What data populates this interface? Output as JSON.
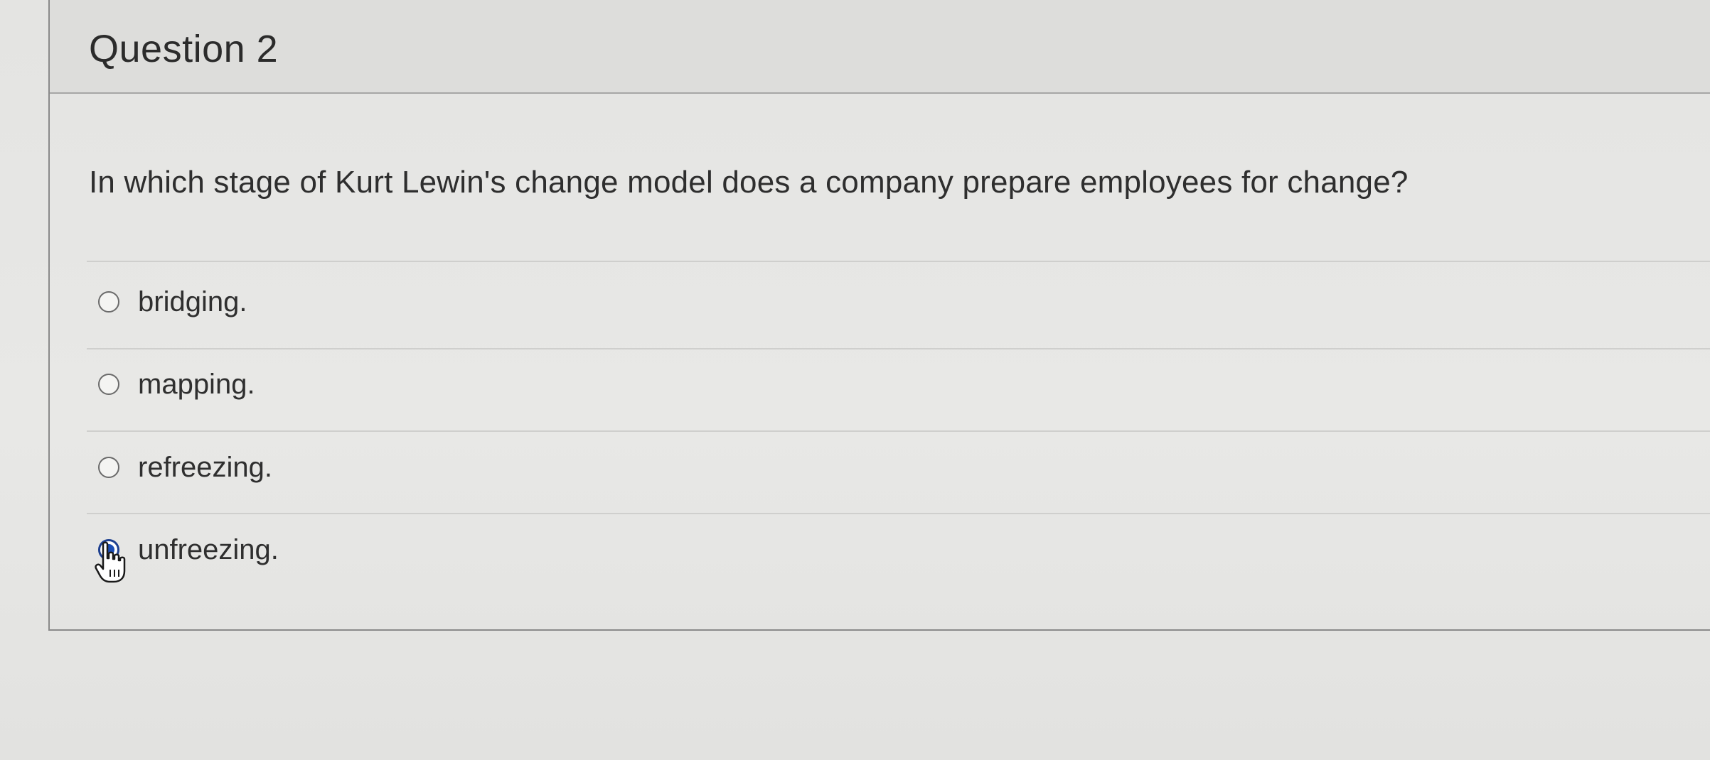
{
  "question": {
    "title": "Question 2",
    "text": "In which stage of Kurt Lewin's change model does a company prepare employees for change?"
  },
  "answers": [
    {
      "label": "bridging.",
      "selected": false
    },
    {
      "label": "mapping.",
      "selected": false
    },
    {
      "label": "refreezing.",
      "selected": false
    },
    {
      "label": "unfreezing.",
      "selected": true
    }
  ],
  "colors": {
    "selected_radio": "#1a4db5",
    "border": "#8a8a8a"
  },
  "icons": {
    "cursor": "hand-pointer-icon"
  }
}
